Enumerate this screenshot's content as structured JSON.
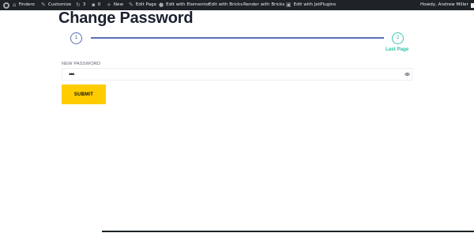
{
  "adminbar": {
    "site_name": "Findero",
    "customize": "Customize",
    "updates_count": "3",
    "comments_count": "0",
    "new_label": "New",
    "edit_page": "Edit Page",
    "edit_elementor": "Edit with Elementor",
    "edit_bricks": "Edit with Bricks",
    "render_bricks": "Render with Bricks",
    "edit_jetplugins": "Edit with JetPlugins",
    "howdy": "Howdy, Andrew Miller"
  },
  "page": {
    "title": "Change Password"
  },
  "steps": {
    "step1": "1",
    "step2": "2",
    "last_label": "Last Page"
  },
  "form": {
    "password_label": "NEW PASSWORD",
    "password_value": "•••",
    "submit_label": "SUBMIT"
  },
  "colors": {
    "adminbar_bg": "#1d2327",
    "accent_blue": "#5a6fb3",
    "accent_teal": "#2fc0a7",
    "submit_bg": "#ffcc00"
  }
}
